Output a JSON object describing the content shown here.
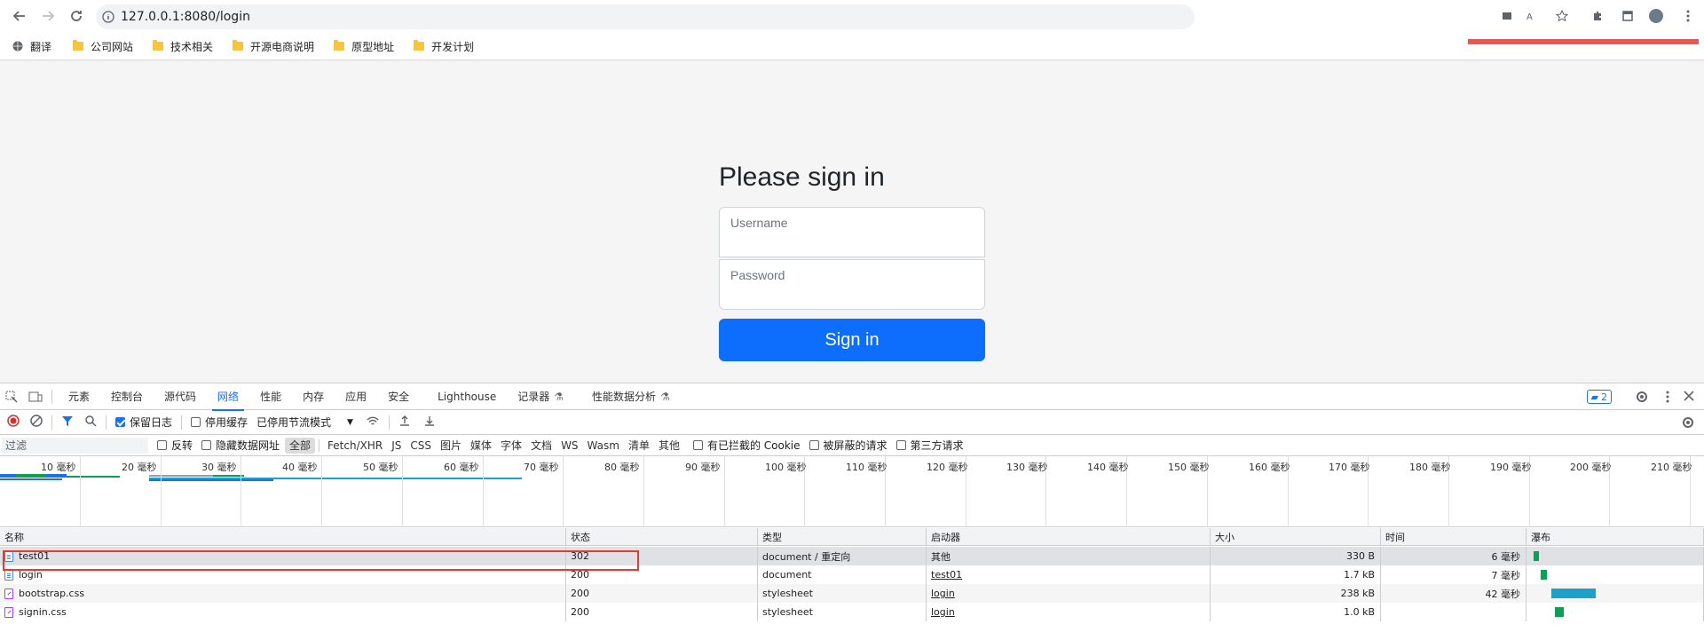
{
  "browser": {
    "url": "127.0.0.1:8080/login",
    "bookmarks": [
      {
        "label": "翻译",
        "icon": "globe-icon"
      },
      {
        "label": "公司网站",
        "icon": "folder-icon"
      },
      {
        "label": "技术相关",
        "icon": "folder-icon"
      },
      {
        "label": "开源电商说明",
        "icon": "folder-icon"
      },
      {
        "label": "原型地址",
        "icon": "folder-icon"
      },
      {
        "label": "开发计划",
        "icon": "folder-icon"
      }
    ]
  },
  "login": {
    "title": "Please sign in",
    "username_placeholder": "Username",
    "password_placeholder": "Password",
    "button": "Sign in"
  },
  "devtools": {
    "tabs": [
      "元素",
      "控制台",
      "源代码",
      "网络",
      "性能",
      "内存",
      "应用",
      "安全",
      "Lighthouse",
      "记录器",
      "性能数据分析"
    ],
    "active_tab": "网络",
    "issues_count": "2",
    "toolbar": {
      "preserve_log": "保留日志",
      "disable_cache": "停用缓存",
      "throttling": "已停用节流模式"
    },
    "filter": {
      "placeholder": "过滤",
      "invert": "反转",
      "hide_data_urls": "隐藏数据网址",
      "types": [
        "全部",
        "Fetch/XHR",
        "JS",
        "CSS",
        "图片",
        "媒体",
        "字体",
        "文档",
        "WS",
        "Wasm",
        "清单",
        "其他"
      ],
      "blocked_cookies": "有已拦截的 Cookie",
      "blocked_requests": "被屏蔽的请求",
      "third_party": "第三方请求"
    },
    "timeline_ticks": [
      "10 毫秒",
      "20 毫秒",
      "30 毫秒",
      "40 毫秒",
      "50 毫秒",
      "60 毫秒",
      "70 毫秒",
      "80 毫秒",
      "90 毫秒",
      "100 毫秒",
      "110 毫秒",
      "120 毫秒",
      "130 毫秒",
      "140 毫秒",
      "150 毫秒",
      "160 毫秒",
      "170 毫秒",
      "180 毫秒",
      "190 毫秒",
      "200 毫秒",
      "210 毫秒"
    ],
    "columns": [
      "名称",
      "状态",
      "类型",
      "启动器",
      "大小",
      "时间",
      "瀑布"
    ],
    "rows": [
      {
        "name": "test01",
        "status": "302",
        "type": "document / 重定向",
        "initiator": "其他",
        "size": "330 B",
        "time": "6 毫秒",
        "icon": "document-icon"
      },
      {
        "name": "login",
        "status": "200",
        "type": "document",
        "initiator": "test01",
        "size": "1.7 kB",
        "time": "7 毫秒",
        "icon": "document-icon"
      },
      {
        "name": "bootstrap.css",
        "status": "200",
        "type": "stylesheet",
        "initiator": "login",
        "size": "238 kB",
        "time": "42 毫秒",
        "icon": "stylesheet-icon"
      },
      {
        "name": "signin.css",
        "status": "200",
        "type": "stylesheet",
        "initiator": "login",
        "size": "1.0 kB",
        "time": "",
        "icon": "stylesheet-icon"
      }
    ]
  }
}
